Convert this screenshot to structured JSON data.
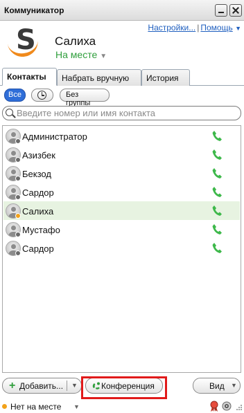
{
  "window": {
    "title": "Коммуникатор"
  },
  "header": {
    "settings_link": "Настройки...",
    "help_link": "Помощь",
    "user_name": "Салиха",
    "status": "На месте"
  },
  "tabs": [
    {
      "label": "Контакты",
      "active": true
    },
    {
      "label": "Набрать вручную",
      "active": false
    },
    {
      "label": "История",
      "active": false
    }
  ],
  "filters": {
    "all": "Все",
    "no_group": "Без группы"
  },
  "search": {
    "placeholder": "Введите номер или имя контакта",
    "value": ""
  },
  "contacts": [
    {
      "name": "Администратор",
      "presence": "offline",
      "selected": false
    },
    {
      "name": "Азизбек",
      "presence": "offline",
      "selected": false
    },
    {
      "name": "Бекзод",
      "presence": "offline",
      "selected": false
    },
    {
      "name": "Сардор",
      "presence": "offline",
      "selected": false
    },
    {
      "name": "Салиха",
      "presence": "away",
      "selected": true
    },
    {
      "name": "Мустафо",
      "presence": "offline",
      "selected": false
    },
    {
      "name": "Сардор",
      "presence": "offline",
      "selected": false
    }
  ],
  "toolbar": {
    "add": "Добавить...",
    "conference": "Конференция",
    "view": "Вид"
  },
  "statusbar": {
    "status": "Нет на месте"
  },
  "colors": {
    "accent": "#2f6ed8",
    "online_green": "#2e9e3b",
    "away": "#f2a21a",
    "highlight": "#e11a1a"
  }
}
